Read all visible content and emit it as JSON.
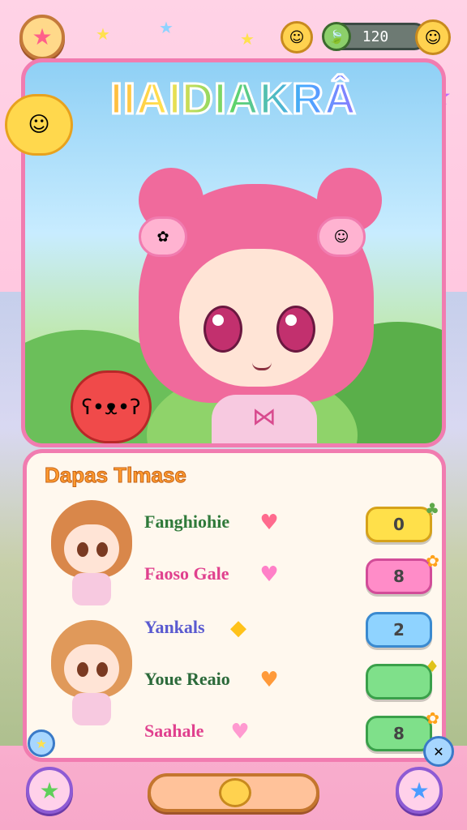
{
  "header": {
    "star_icon": "star-icon",
    "currency_value": "120",
    "coin_left_icon": "coin-face-icon",
    "coin_right_icon": "coin-face-icon",
    "leaf_icon": "leaf-icon"
  },
  "hero": {
    "title": "IIAIDIAKRÂ"
  },
  "panel": {
    "title": "Dapas Tlmase",
    "rows": [
      {
        "name": "Fanghiohie",
        "name_color": "#2f7a3a",
        "heart": "♥",
        "heart_color": "#ff6b8e",
        "pill_color": "#ffe04a",
        "pill_border": "#d6a21a",
        "pill_text": "0"
      },
      {
        "name": "Faoso Gale",
        "name_color": "#e0408e",
        "heart": "♥",
        "heart_color": "#ff80c8",
        "pill_color": "#ff8cc8",
        "pill_border": "#d24c98",
        "pill_text": "8"
      },
      {
        "name": "Yankals",
        "name_color": "#5a5ad0",
        "heart": "◆",
        "heart_color": "#ffc21a",
        "pill_color": "#8fd3ff",
        "pill_border": "#3a8ad0",
        "pill_text": "2"
      },
      {
        "name": "Youe Reaio",
        "name_color": "#2c6a3a",
        "heart": "♥",
        "heart_color": "#ff9a3a",
        "pill_color": "#7fe08a",
        "pill_border": "#3aa04a",
        "pill_text": ""
      },
      {
        "name": "Saahale",
        "name_color": "#e0408e",
        "heart": "♥",
        "heart_color": "#ff9ad0",
        "pill_color": "#7fe08a",
        "pill_border": "#3aa04a",
        "pill_text": "8"
      }
    ]
  },
  "footer": {
    "left_icon": "★",
    "right_icon": "★"
  }
}
